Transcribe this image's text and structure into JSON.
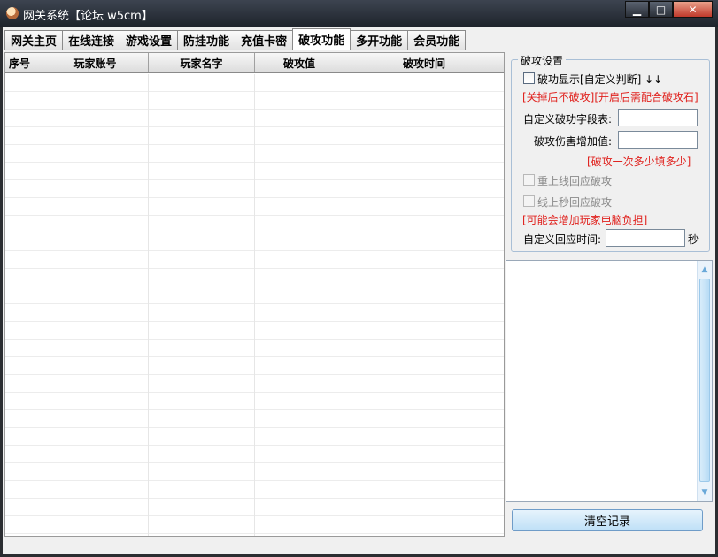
{
  "window": {
    "title": "网关系统【论坛 w5cm】",
    "controls": [
      "▁",
      "□",
      "✕"
    ]
  },
  "tabs": [
    {
      "label": "网关主页",
      "active": false
    },
    {
      "label": "在线连接",
      "active": false
    },
    {
      "label": "游戏设置",
      "active": false
    },
    {
      "label": "防挂功能",
      "active": false
    },
    {
      "label": "充值卡密",
      "active": false
    },
    {
      "label": "破攻功能",
      "active": true
    },
    {
      "label": "多开功能",
      "active": false
    },
    {
      "label": "会员功能",
      "active": false
    }
  ],
  "table": {
    "columns": [
      "序号",
      "玩家账号",
      "玩家名字",
      "破攻值",
      "破攻时间"
    ],
    "rows": []
  },
  "settings": {
    "group_title": "破攻设置",
    "show_checkbox_label": "破功显示[自定义判断] ↓↓",
    "show_note": "[关掉后不破攻][开启后需配合破攻石]",
    "field_label": "自定义破功字段表:",
    "field_value": "",
    "damage_label": "破攻伤害增加值:",
    "damage_value": "",
    "damage_note": "[破攻一次多少填多少]",
    "relogin_label": "重上线回应破攻",
    "second_label": "线上秒回应破攻",
    "load_note": "[可能会增加玩家电脑负担]",
    "time_label": "自定义回应时间:",
    "time_value": "",
    "time_unit": "秒"
  },
  "actions": {
    "clear_label": "清空记录"
  },
  "colors": {
    "warning_text": "#e0201c",
    "button_bg": "#bfe0f7"
  }
}
